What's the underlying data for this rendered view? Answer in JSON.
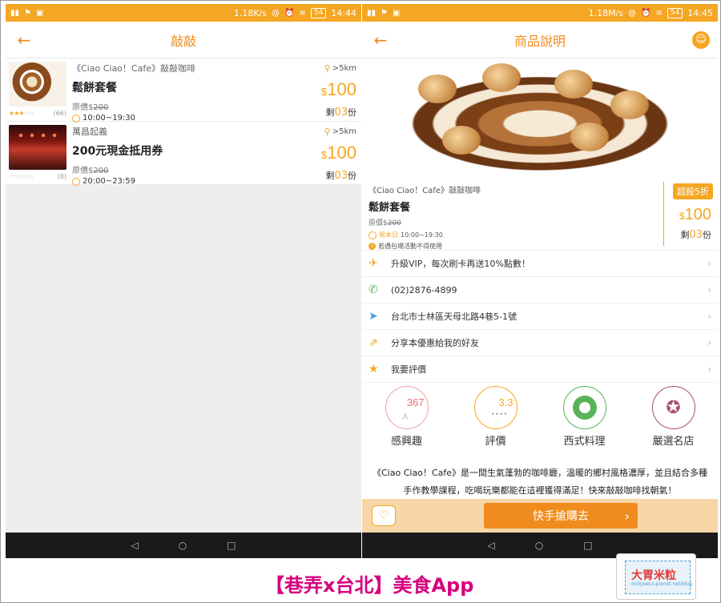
{
  "left": {
    "status": {
      "speed": "1.18K/s",
      "battery": "54",
      "time": "14:44"
    },
    "title": "敲敲",
    "deals": [
      {
        "shop": "《Ciao Ciao！Cafe》敲敲咖啡",
        "name": "鬆餅套餐",
        "orig_label": "原價$",
        "orig_price": "200",
        "hours": "10:00~19:30",
        "distance": ">5km",
        "currency": "$",
        "price": "100",
        "remain_label": "剩",
        "remain_count": "03",
        "remain_unit": "份",
        "rating_count": "(66)",
        "stars": 3
      },
      {
        "shop": "萬昌起義",
        "name": "200元現金抵用券",
        "orig_label": "原價$",
        "orig_price": "200",
        "hours": "20:00~23:59",
        "distance": ">5km",
        "currency": "$",
        "price": "100",
        "remain_label": "剩",
        "remain_count": "03",
        "remain_unit": "份",
        "rating_count": "(0)",
        "stars": 0
      }
    ]
  },
  "right": {
    "status": {
      "speed": "1.18M/s",
      "battery": "54",
      "time": "14:45"
    },
    "title": "商品說明",
    "summary": {
      "shop": "《Ciao Ciao！Cafe》敲敲咖啡",
      "name": "鬆餅套餐",
      "orig_label": "原價$",
      "orig_price": "200",
      "limit_tag": "限本日",
      "hours": "10:00~19:30",
      "note": "若遇包場活動不得使用",
      "discount": "超殺5折",
      "currency": "$",
      "price": "100",
      "remain_label": "剩",
      "remain_count": "03",
      "remain_unit": "份"
    },
    "menu": [
      {
        "icon": "upgrade-icon",
        "label": "升級VIP，每次刷卡再送10%點數！"
      },
      {
        "icon": "phone-icon",
        "label": "(02)2876-4899"
      },
      {
        "icon": "location-arrow-icon",
        "label": "台北市士林區天母北路4巷5-1號"
      },
      {
        "icon": "share-icon",
        "label": "分享本優惠給我的好友"
      },
      {
        "icon": "star-icon",
        "label": "我要評價"
      }
    ],
    "badges": [
      {
        "num": "367",
        "sub": "人",
        "label": "感興趣"
      },
      {
        "num": "3.3",
        "sub": "••••",
        "label": "評價"
      },
      {
        "label": "西式料理"
      },
      {
        "label": "嚴選名店"
      }
    ],
    "description": "《Ciao Ciao！Cafe》是一間生氣蓬勃的咖啡廳，溫暖的鄉村風格濃厚，並且結合多種手作教學課程，吃喝玩樂都能在這裡獲得滿足！快來敲敲咖啡找朝氣！",
    "buy_label": "快手搶購去"
  },
  "caption": "【巷弄x台北】美食App",
  "logo": {
    "brand": "大胃米粒",
    "url": "millyeeco.pixnet.net/blog"
  },
  "colors": {
    "accent": "#f5a623",
    "accent_dark": "#f08c1e",
    "caption": "#d6007e"
  }
}
